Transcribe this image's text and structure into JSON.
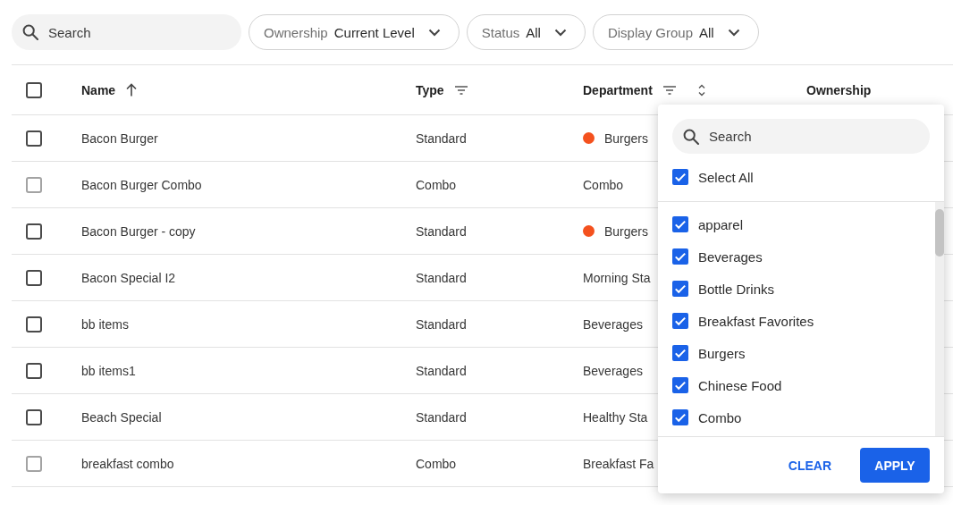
{
  "toolbar": {
    "search": {
      "placeholder": "Search"
    },
    "filters": [
      {
        "label": "Ownership",
        "value": "Current Level"
      },
      {
        "label": "Status",
        "value": "All"
      },
      {
        "label": "Display Group",
        "value": "All"
      }
    ]
  },
  "table": {
    "select_all": {
      "checked": false
    },
    "columns": [
      {
        "label": "Name",
        "sorted": true,
        "sortable": true,
        "filter": false
      },
      {
        "label": "Type",
        "sorted": false,
        "sortable": false,
        "filter": true
      },
      {
        "label": "Department",
        "sorted": false,
        "sortable": true,
        "filter": true
      },
      {
        "label": "Ownership",
        "sorted": false,
        "sortable": false,
        "filter": false
      }
    ],
    "rows": [
      {
        "checked": false,
        "disabled": false,
        "name": "Bacon Burger",
        "type": "Standard",
        "department": {
          "text": "Burgers",
          "color": "#f4511e"
        }
      },
      {
        "checked": false,
        "disabled": true,
        "name": "Bacon Burger Combo",
        "type": "Combo",
        "department": {
          "text": "Combo"
        }
      },
      {
        "checked": false,
        "disabled": false,
        "name": "Bacon Burger - copy",
        "type": "Standard",
        "department": {
          "text": "Burgers",
          "color": "#f4511e"
        }
      },
      {
        "checked": false,
        "disabled": false,
        "name": "Bacon Special I2",
        "type": "Standard",
        "department": {
          "text": "Morning Sta"
        }
      },
      {
        "checked": false,
        "disabled": false,
        "name": "bb items",
        "type": "Standard",
        "department": {
          "text": "Beverages"
        }
      },
      {
        "checked": false,
        "disabled": false,
        "name": "bb items1",
        "type": "Standard",
        "department": {
          "text": "Beverages"
        }
      },
      {
        "checked": false,
        "disabled": false,
        "name": "Beach Special",
        "type": "Standard",
        "department": {
          "text": "Healthy Sta"
        }
      },
      {
        "checked": false,
        "disabled": true,
        "name": "breakfast combo",
        "type": "Combo",
        "department": {
          "text": "Breakfast Fa"
        }
      }
    ]
  },
  "department_filter": {
    "search": {
      "placeholder": "Search"
    },
    "select_all": {
      "label": "Select All",
      "checked": true
    },
    "options": [
      {
        "label": "apparel",
        "checked": true
      },
      {
        "label": "Beverages",
        "checked": true
      },
      {
        "label": "Bottle Drinks",
        "checked": true
      },
      {
        "label": "Breakfast Favorites",
        "checked": true
      },
      {
        "label": "Burgers",
        "checked": true
      },
      {
        "label": "Chinese Food",
        "checked": true
      },
      {
        "label": "Combo",
        "checked": true
      }
    ],
    "buttons": [
      {
        "label": "CLEAR",
        "kind": "text"
      },
      {
        "label": "APPLY",
        "kind": "primary"
      }
    ]
  }
}
